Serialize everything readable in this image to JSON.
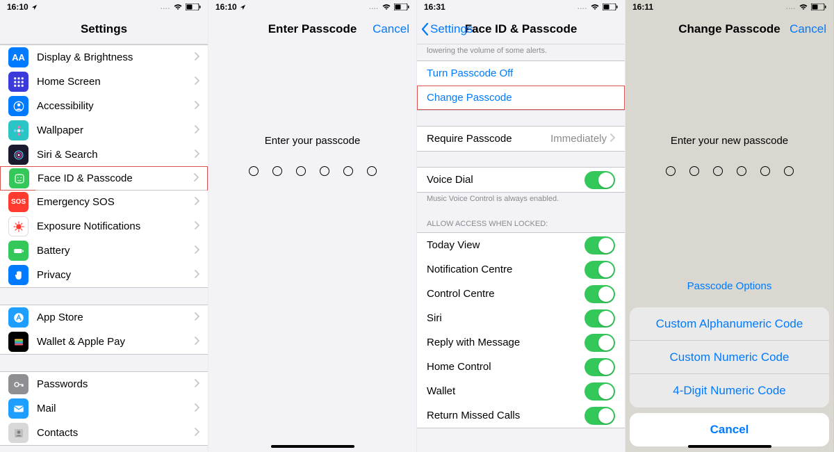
{
  "status": {
    "panel1_time": "16:10",
    "panel2_time": "16:10",
    "panel3_time": "16:31",
    "panel4_time": "16:11"
  },
  "panel1": {
    "title": "Settings",
    "group1": [
      {
        "label": "Display & Brightness",
        "icon_bg": "#007aff",
        "icon": "AA"
      },
      {
        "label": "Home Screen",
        "icon_bg": "#3b3bdb",
        "icon": "grid"
      },
      {
        "label": "Accessibility",
        "icon_bg": "#007aff",
        "icon": "person"
      },
      {
        "label": "Wallpaper",
        "icon_bg": "#2ac4c4",
        "icon": "flower"
      },
      {
        "label": "Siri & Search",
        "icon_bg": "#1a1a2e",
        "icon": "siri"
      },
      {
        "label": "Face ID & Passcode",
        "icon_bg": "#34c759",
        "icon": "face",
        "highlight": true
      },
      {
        "label": "Emergency SOS",
        "icon_bg": "#ff3b30",
        "icon": "SOS"
      },
      {
        "label": "Exposure Notifications",
        "icon_bg": "#ffffff",
        "icon": "covid"
      },
      {
        "label": "Battery",
        "icon_bg": "#34c759",
        "icon": "battery"
      },
      {
        "label": "Privacy",
        "icon_bg": "#007aff",
        "icon": "hand"
      }
    ],
    "group2": [
      {
        "label": "App Store",
        "icon_bg": "#1e9eff",
        "icon": "appstore"
      },
      {
        "label": "Wallet & Apple Pay",
        "icon_bg": "#000000",
        "icon": "wallet"
      }
    ],
    "group3": [
      {
        "label": "Passwords",
        "icon_bg": "#8e8e93",
        "icon": "key"
      },
      {
        "label": "Mail",
        "icon_bg": "#1e9eff",
        "icon": "mail"
      },
      {
        "label": "Contacts",
        "icon_bg": "#d8d8d8",
        "icon": "contacts"
      }
    ]
  },
  "panel2": {
    "title": "Enter Passcode",
    "cancel": "Cancel",
    "prompt": "Enter your passcode"
  },
  "panel3": {
    "back": "Settings",
    "title": "Face ID & Passcode",
    "hint_top": "lowering the volume of some alerts.",
    "turn_off": "Turn Passcode Off",
    "change": "Change Passcode",
    "require": {
      "label": "Require Passcode",
      "value": "Immediately"
    },
    "voice_dial": "Voice Dial",
    "voice_hint": "Music Voice Control is always enabled.",
    "allow_header": "ALLOW ACCESS WHEN LOCKED:",
    "allow_items": [
      "Today View",
      "Notification Centre",
      "Control Centre",
      "Siri",
      "Reply with Message",
      "Home Control",
      "Wallet",
      "Return Missed Calls"
    ]
  },
  "panel4": {
    "title": "Change Passcode",
    "cancel": "Cancel",
    "prompt": "Enter your new passcode",
    "options_link": "Passcode Options",
    "sheet_items": [
      "Custom Alphanumeric Code",
      "Custom Numeric Code",
      "4-Digit Numeric Code"
    ],
    "sheet_cancel": "Cancel"
  }
}
